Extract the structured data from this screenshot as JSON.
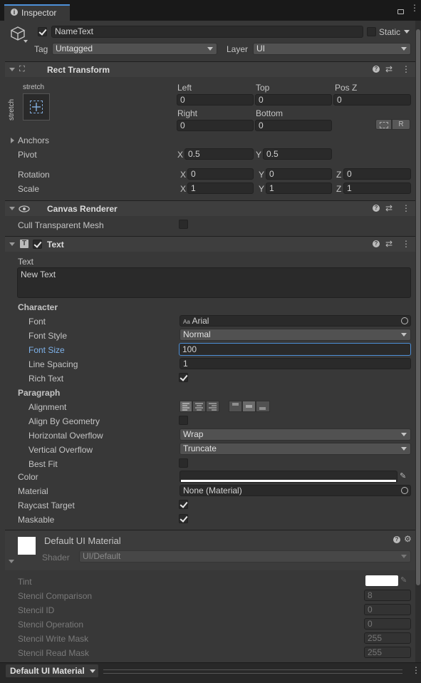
{
  "tab": {
    "title": "Inspector"
  },
  "object": {
    "name": "NameText",
    "static_label": "Static",
    "tag_label": "Tag",
    "tag_value": "Untagged",
    "layer_label": "Layer",
    "layer_value": "UI"
  },
  "rect_transform": {
    "title": "Rect Transform",
    "anchor_preset_h": "stretch",
    "anchor_preset_v": "stretch",
    "left_label": "Left",
    "left": "0",
    "top_label": "Top",
    "top": "0",
    "posz_label": "Pos Z",
    "posz": "0",
    "right_label": "Right",
    "right": "0",
    "bottom_label": "Bottom",
    "bottom": "0",
    "raw_button": "R",
    "anchors_label": "Anchors",
    "pivot_label": "Pivot",
    "pivot_x": "0.5",
    "pivot_y": "0.5",
    "rotation_label": "Rotation",
    "rot_x": "0",
    "rot_y": "0",
    "rot_z": "0",
    "scale_label": "Scale",
    "scale_x": "1",
    "scale_y": "1",
    "scale_z": "1",
    "x": "X",
    "y": "Y",
    "z": "Z"
  },
  "canvas_renderer": {
    "title": "Canvas Renderer",
    "cull_label": "Cull Transparent Mesh",
    "cull": false
  },
  "text": {
    "title": "Text",
    "text_label": "Text",
    "text_value": "New Text",
    "character_label": "Character",
    "font_label": "Font",
    "font_value": "Arial",
    "font_prefix": "Aa",
    "font_style_label": "Font Style",
    "font_style_value": "Normal",
    "font_size_label": "Font Size",
    "font_size_value": "100",
    "line_spacing_label": "Line Spacing",
    "line_spacing_value": "1",
    "rich_text_label": "Rich Text",
    "rich_text": true,
    "paragraph_label": "Paragraph",
    "alignment_label": "Alignment",
    "align_geom_label": "Align By Geometry",
    "align_geom": false,
    "h_overflow_label": "Horizontal Overflow",
    "h_overflow_value": "Wrap",
    "v_overflow_label": "Vertical Overflow",
    "v_overflow_value": "Truncate",
    "best_fit_label": "Best Fit",
    "best_fit": false,
    "color_label": "Color",
    "color_value": "#ffffff",
    "material_label": "Material",
    "material_value": "None (Material)",
    "raycast_label": "Raycast Target",
    "raycast": true,
    "maskable_label": "Maskable",
    "maskable": true
  },
  "material": {
    "title": "Default UI Material",
    "shader_label": "Shader",
    "shader_value": "UI/Default",
    "tint_label": "Tint",
    "stencil_comp_label": "Stencil Comparison",
    "stencil_comp": "8",
    "stencil_id_label": "Stencil ID",
    "stencil_id": "0",
    "stencil_op_label": "Stencil Operation",
    "stencil_op": "0",
    "stencil_write_label": "Stencil Write Mask",
    "stencil_write": "255",
    "stencil_read_label": "Stencil Read Mask",
    "stencil_read": "255"
  },
  "footer": {
    "label": "Default UI Material"
  },
  "colors": {
    "accent": "#4d90d8",
    "panel": "#383838",
    "field": "#2a2a2a"
  }
}
